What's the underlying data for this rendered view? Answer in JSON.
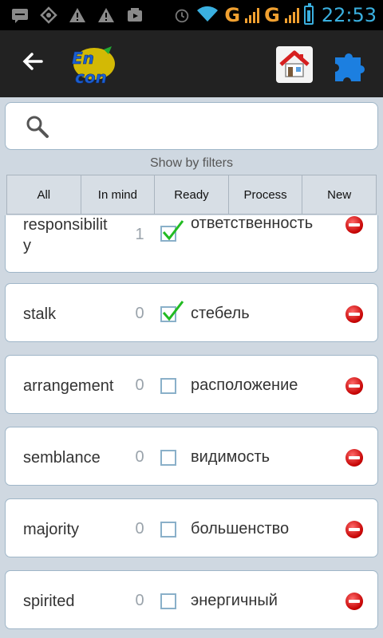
{
  "status_bar": {
    "time": "22:53",
    "network_1": "G",
    "network_2": "G",
    "icons": [
      "sms-icon",
      "android-icon",
      "warning-icon",
      "warning-icon",
      "media-icon",
      "alarm-icon",
      "wifi-icon",
      "signal-icon",
      "signal-icon",
      "battery-icon"
    ]
  },
  "app_bar": {
    "back_icon": "arrow-left-icon",
    "logo_text_top": "En",
    "logo_text_bottom": "con",
    "home_icon": "home-icon",
    "puzzle_icon": "puzzle-icon"
  },
  "search": {
    "placeholder": "",
    "value": ""
  },
  "filters": {
    "label": "Show by filters",
    "buttons": [
      "All",
      "In mind",
      "Ready",
      "Process",
      "New"
    ]
  },
  "words": [
    {
      "word": "responsibility",
      "word_line1": "responsibilit",
      "word_line2": "y",
      "count": "1",
      "checked": true,
      "translation": "ответственность"
    },
    {
      "word": "stalk",
      "count": "0",
      "checked": true,
      "translation": "стебель"
    },
    {
      "word": "arrangement",
      "count": "0",
      "checked": false,
      "translation": "расположение"
    },
    {
      "word": "semblance",
      "count": "0",
      "checked": false,
      "translation": "видимость"
    },
    {
      "word": "majority",
      "count": "0",
      "checked": false,
      "translation": "большенство"
    },
    {
      "word": "spirited",
      "count": "0",
      "checked": false,
      "translation": "энергичный"
    }
  ],
  "colors": {
    "accent_blue": "#3ab0e0",
    "signal_orange": "#f0a030",
    "check_green": "#22bb22",
    "delete_red": "#c40000"
  }
}
